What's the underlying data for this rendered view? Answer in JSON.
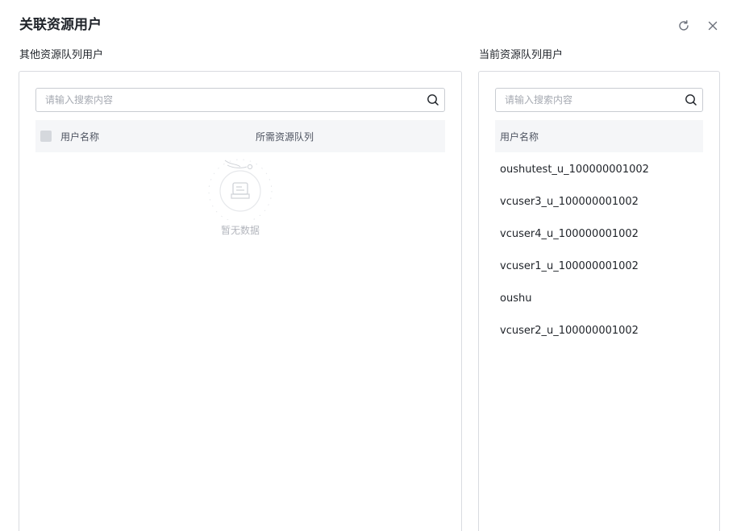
{
  "dialog": {
    "title": "关联资源用户",
    "refresh_icon": "refresh-icon",
    "close_icon": "close-icon"
  },
  "left_panel": {
    "label": "其他资源队列用户",
    "search": {
      "placeholder": "请输入搜索内容",
      "value": ""
    },
    "columns": [
      "用户名称",
      "所需资源队列"
    ],
    "empty_text": "暂无数据",
    "rows": []
  },
  "right_panel": {
    "label": "当前资源队列用户",
    "search": {
      "placeholder": "请输入搜索内容",
      "value": ""
    },
    "columns": [
      "用户名称"
    ],
    "users": [
      "oushutest_u_100000001002",
      "vcuser3_u_100000001002",
      "vcuser4_u_100000001002",
      "vcuser1_u_100000001002",
      "oushu",
      "vcuser2_u_100000001002"
    ]
  },
  "colors": {
    "text": "#1f2329",
    "muted": "#a6aab2",
    "header_bg": "#f5f6f8",
    "border": "#d9dbe0"
  }
}
